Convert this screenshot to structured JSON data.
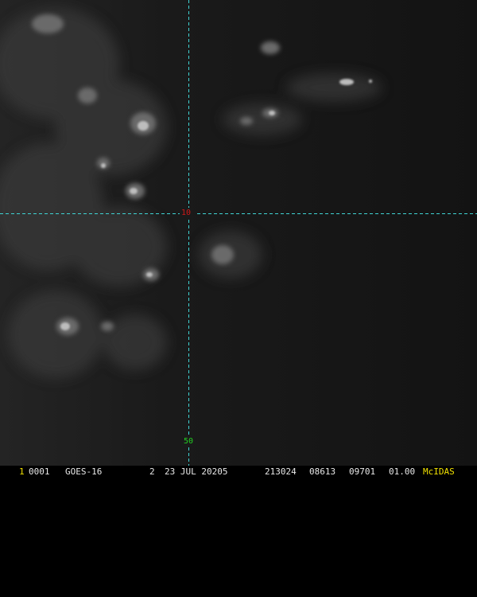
{
  "colors": {
    "grid_line": "#3fd4d4",
    "lat_label": "#d01818",
    "lon_label": "#22d022",
    "frame_number": "#f0e000",
    "status_text": "#e8e8e8",
    "software_label": "#f0e000",
    "background": "#141414"
  },
  "image": {
    "grid_labels": {
      "latitude": "10",
      "longitude": "50"
    }
  },
  "status_bar": {
    "frame_number": "1",
    "frame_id": "0001",
    "satellite": "GOES-16",
    "band": "2",
    "date": "23 JUL 20205",
    "time": "213024",
    "field_a": "08613",
    "field_b": "09701",
    "scale": "01.00",
    "software": "McIDAS"
  }
}
